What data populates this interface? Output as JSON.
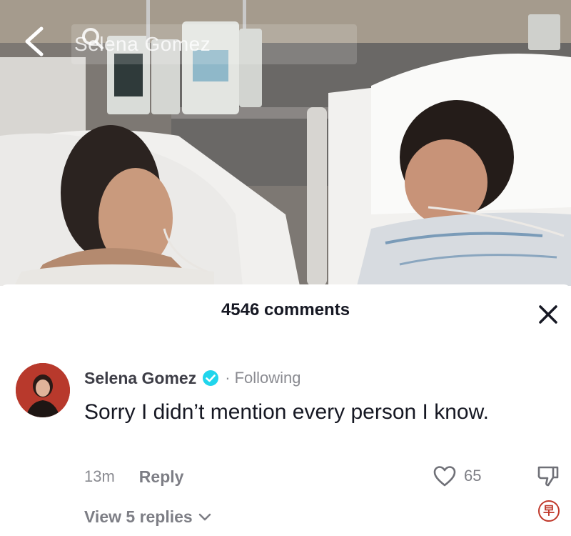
{
  "video": {
    "search": {
      "query": "Selena Gomez"
    }
  },
  "comments_panel": {
    "count_label": "4546 comments",
    "comment": {
      "author": "Selena Gomez",
      "separator": "·",
      "follow_status": "Following",
      "text": "Sorry I didn’t mention every person I know.",
      "timestamp": "13m",
      "reply_label": "Reply",
      "like_count": "65",
      "view_replies_label": "View 5 replies"
    }
  },
  "icons": {
    "back": "chevron-left-icon",
    "search": "search-icon",
    "close": "close-icon",
    "verified": "verified-badge-icon",
    "like": "heart-icon",
    "dislike": "thumbs-down-icon",
    "expand": "chevron-down-icon"
  },
  "colors": {
    "primary_text": "#161823",
    "secondary_text": "#8a8b91",
    "verified": "#20d5ec",
    "sheet_bg": "#ffffff"
  }
}
